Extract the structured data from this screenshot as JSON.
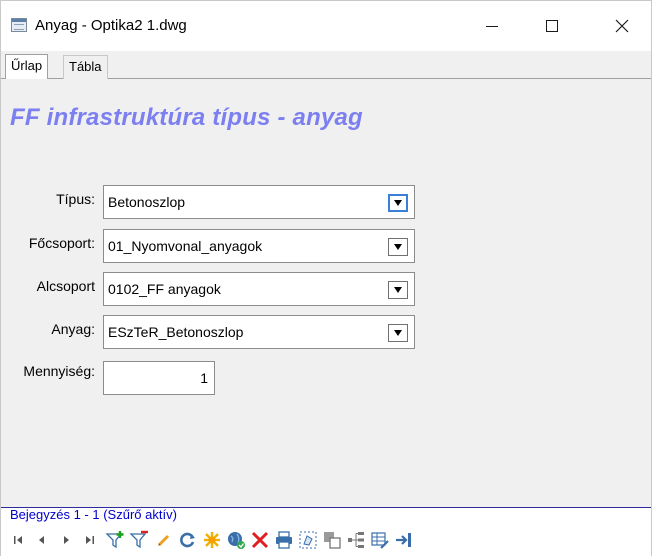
{
  "window": {
    "title": "Anyag - Optika2 1.dwg"
  },
  "tabs": [
    {
      "label": "Űrlap",
      "active": true
    },
    {
      "label": "Tábla",
      "active": false
    }
  ],
  "form": {
    "heading": "FF infrastruktúra típus - anyag",
    "fields": {
      "tipus": {
        "label": "Típus:",
        "value": "Betonoszlop"
      },
      "focsoport": {
        "label": "Főcsoport:",
        "value": "01_Nyomvonal_anyagok"
      },
      "alcsoport": {
        "label": "Alcsoport",
        "value": "0102_FF anyagok"
      },
      "anyag": {
        "label": "Anyag:",
        "value": "ESzTeR_Betonoszlop"
      },
      "mennyiseg": {
        "label": "Mennyiség:",
        "value": "1"
      }
    }
  },
  "status": {
    "text": "Bejegyzés 1 - 1 (Szűrő aktív)"
  },
  "toolbar": {
    "icons": [
      "first-record-icon",
      "previous-record-icon",
      "next-record-icon",
      "last-record-icon",
      "add-filter-icon",
      "remove-filter-icon",
      "edit-icon",
      "refresh-icon",
      "highlight-icon",
      "zoom-to-icon",
      "delete-icon",
      "print-icon",
      "select-icon",
      "copy-icon",
      "properties-icon",
      "table-edit-icon",
      "exit-icon"
    ]
  },
  "colors": {
    "heading": "#7b7ff0",
    "status_text": "#0000cc",
    "focus_border": "#3c7fd6",
    "delete_red": "#e02020"
  }
}
